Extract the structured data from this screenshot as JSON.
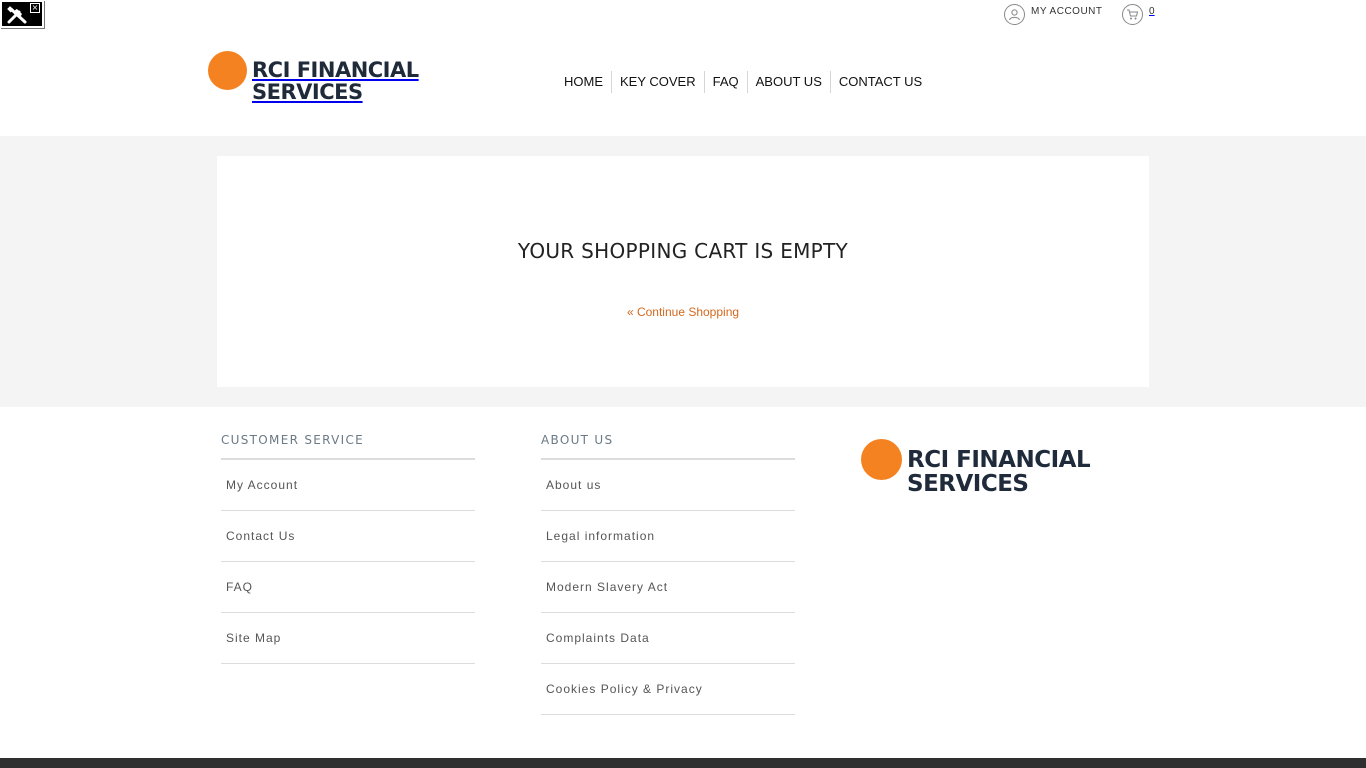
{
  "brand": {
    "line1": "RCI FINANCIAL",
    "line2": "SERVICES",
    "color": "#f58220"
  },
  "topbar": {
    "account_label": "MY ACCOUNT",
    "cart_count": "0"
  },
  "nav": {
    "items": [
      "HOME",
      "KEY COVER",
      "FAQ",
      "ABOUT US",
      "CONTACT US"
    ]
  },
  "cart": {
    "heading": "YOUR SHOPPING CART IS EMPTY",
    "continue_label": "« Continue Shopping",
    "link_color": "#d2691e"
  },
  "footer": {
    "customer_service": {
      "title": "CUSTOMER SERVICE",
      "links": [
        "My Account",
        "Contact Us",
        "FAQ",
        "Site Map"
      ]
    },
    "about_us": {
      "title": "ABOUT US",
      "links": [
        "About us",
        "Legal information",
        "Modern Slavery Act",
        "Complaints Data",
        "Cookies Policy & Privacy"
      ]
    }
  },
  "icons": {
    "debug": "tools-icon",
    "close": "close-icon",
    "account": "user-icon",
    "cart": "cart-icon"
  }
}
